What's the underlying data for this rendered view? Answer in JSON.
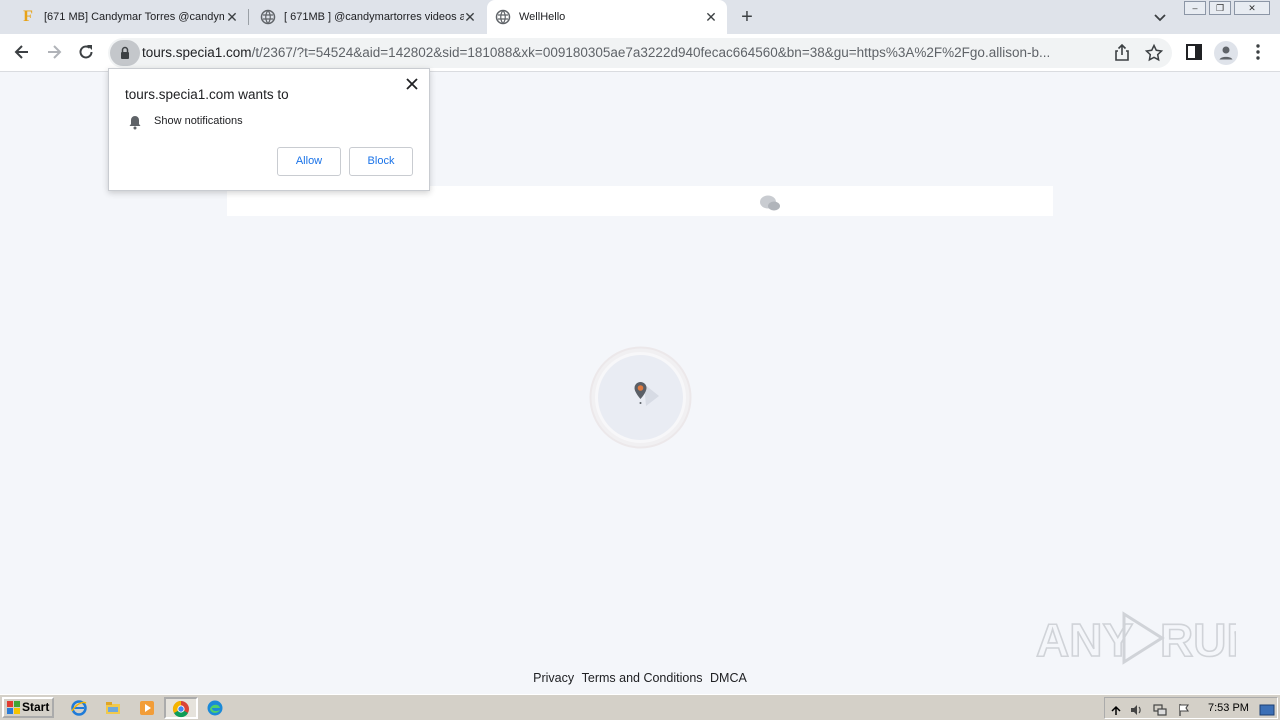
{
  "browser": {
    "tabs": [
      {
        "title": "[671 MB] Candymar Torres @candym",
        "active": false,
        "favicon": "f-letter-icon"
      },
      {
        "title": "[ 671MB ] @candymartorres videos a",
        "active": false,
        "favicon": "globe-icon"
      },
      {
        "title": "WellHello",
        "active": true,
        "favicon": "globe-icon"
      }
    ],
    "url_host": "tours.specia1.com",
    "url_path": "/t/2367/?t=54524&aid=142802&sid=181088&xk=009180305ae7a3222d940fecac664560&bn=38&gu=https%3A%2F%2Fgo.allison-b..."
  },
  "permission_popup": {
    "title": "tours.specia1.com wants to",
    "permission": "Show notifications",
    "allow_label": "Allow",
    "block_label": "Block"
  },
  "page": {
    "footer_links": [
      "Privacy",
      "Terms and Conditions",
      "DMCA"
    ],
    "watermark": "ANY RUN"
  },
  "taskbar": {
    "start_label": "Start",
    "clock": "7:53 PM"
  },
  "colors": {
    "accent": "#1a73e8",
    "page_bg": "#f4f6fa",
    "pin": "#e07a3f"
  }
}
